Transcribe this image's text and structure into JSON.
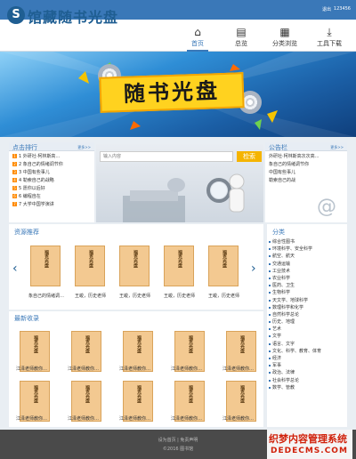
{
  "topbar": {
    "user": "123456",
    "link": "退出"
  },
  "logo": {
    "mark": "S",
    "text": "馆藏随书光盘"
  },
  "nav": [
    {
      "label": "首页",
      "icon": "home-icon"
    },
    {
      "label": "总览",
      "icon": "overview-icon"
    },
    {
      "label": "分类浏览",
      "icon": "category-icon"
    },
    {
      "label": "工具下载",
      "icon": "download-icon"
    }
  ],
  "banner": {
    "title": "随书光盘"
  },
  "ranking": {
    "title": "点击排行",
    "more": "更多>>",
    "items": [
      "1 外研社·柯林斯高…",
      "2 象自己的情绪调节你",
      "3 中国有些事儿",
      "4 勒索自己的战略",
      "5 愿你以后好",
      "6 编程自在",
      "7 大学中国学演讲"
    ]
  },
  "search": {
    "placeholder": "输入内容",
    "button": "检索"
  },
  "notice": {
    "title": "公告栏",
    "more": "更多>>",
    "items": [
      "外研社·柯林斯高次次高…",
      "象自己的情绪调节你",
      "中国有些事儿",
      "勒索自己的战"
    ]
  },
  "resources": {
    "title": "资源推荐",
    "books": [
      {
        "cover": "福克光盘",
        "caption": "象自己的情绪调…"
      },
      {
        "cover": "福克光盘",
        "caption": "王峻，历史老师"
      },
      {
        "cover": "福克光盘",
        "caption": "王峻，历史老师"
      },
      {
        "cover": "福克光盘",
        "caption": "王峻，历史老师"
      },
      {
        "cover": "福克光盘",
        "caption": "王峻，历史老师"
      }
    ]
  },
  "newest": {
    "title": "最新收录",
    "books": [
      {
        "cover": "福克光盘",
        "caption": "江泽老师教你…"
      },
      {
        "cover": "福克光盘",
        "caption": "江泽老师教你…"
      },
      {
        "cover": "福克光盘",
        "caption": "江泽老师教你…"
      },
      {
        "cover": "福克光盘",
        "caption": "江泽老师教你…"
      },
      {
        "cover": "福克光盘",
        "caption": "江泽老师教你…"
      },
      {
        "cover": "福克光盘",
        "caption": "江泽老师教你…"
      },
      {
        "cover": "福克光盘",
        "caption": "江泽老师教你…"
      },
      {
        "cover": "福克光盘",
        "caption": "江泽老师教你…"
      },
      {
        "cover": "福克光盘",
        "caption": "江泽老师教你…"
      },
      {
        "cover": "福克光盘",
        "caption": "江泽老师教你…"
      }
    ]
  },
  "categories": {
    "title": "分类",
    "items": [
      "综合性图书",
      "环境科学、安全科学",
      "航空、航天",
      "交通运输",
      "工业技术",
      "农业科学",
      "医药、卫生",
      "生物科学",
      "天文学、地球科学",
      "数理科学和化学",
      "自然科学总论",
      "历史、地理",
      "艺术",
      "文学",
      "语言、文字",
      "文化、科学、教育、体育",
      "经济",
      "军事",
      "政治、法律",
      "社会科学总论",
      "数学、管教"
    ]
  },
  "footer": {
    "links": "设为首页 | 免责声明",
    "copy": "©2016 图书馆"
  },
  "watermark": {
    "line1": "织梦内容管理系统",
    "line2": "DEDECMS.COM"
  }
}
